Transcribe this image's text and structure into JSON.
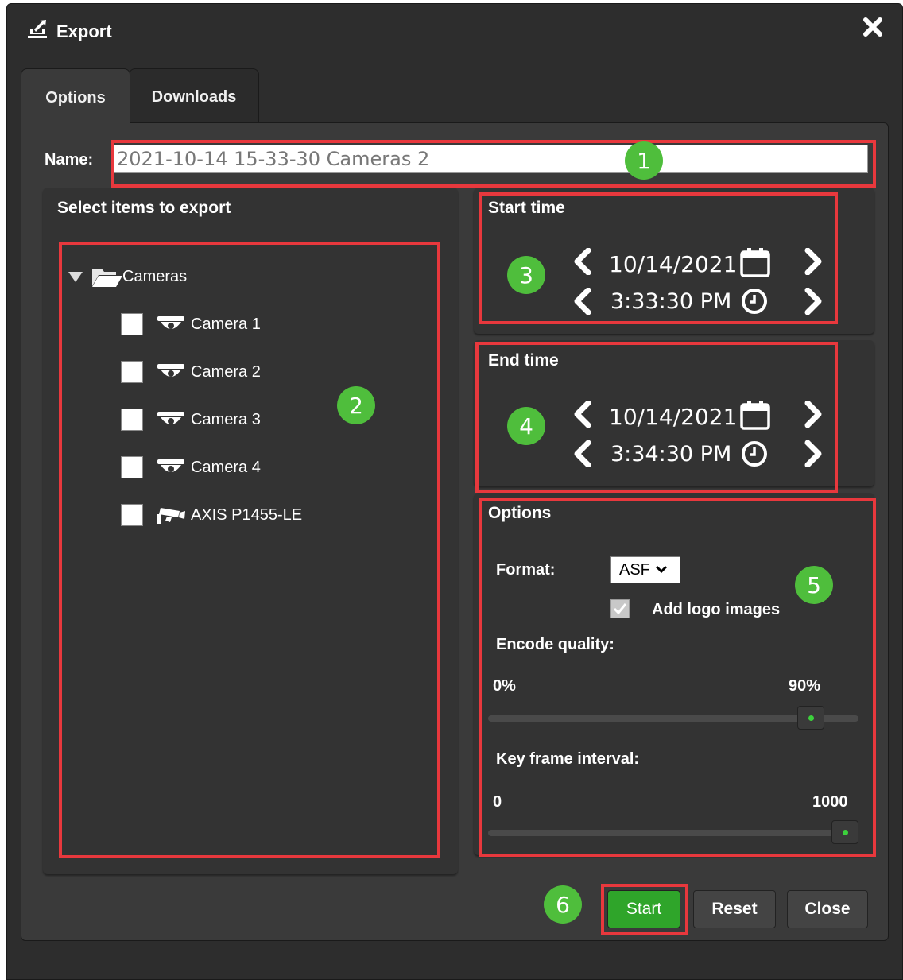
{
  "dialog": {
    "title": "Export",
    "accent_color": "#4fbe3c",
    "highlight_color": "#e8383d"
  },
  "tabs": [
    {
      "label": "Options",
      "active": true
    },
    {
      "label": "Downloads",
      "active": false
    }
  ],
  "name_field": {
    "label": "Name:",
    "value": "2021-10-14 15-33-30 Cameras 2"
  },
  "items_panel": {
    "title": "Select items to export",
    "root": {
      "label": "Cameras",
      "icon": "folder-open-icon",
      "expanded": true
    },
    "items": [
      {
        "label": "Camera 1",
        "icon": "dome-camera-icon",
        "checked": false
      },
      {
        "label": "Camera 2",
        "icon": "dome-camera-icon",
        "checked": false
      },
      {
        "label": "Camera 3",
        "icon": "dome-camera-icon",
        "checked": false
      },
      {
        "label": "Camera 4",
        "icon": "dome-camera-icon",
        "checked": false
      },
      {
        "label": "AXIS P1455-LE",
        "icon": "bullet-camera-icon",
        "checked": false
      }
    ]
  },
  "start_time": {
    "title": "Start time",
    "date": "10/14/2021",
    "time": "3:33:30 PM"
  },
  "end_time": {
    "title": "End time",
    "date": "10/14/2021",
    "time": "3:34:30 PM"
  },
  "options": {
    "title": "Options",
    "format_label": "Format:",
    "format_value": "ASF",
    "add_logo_label": "Add logo images",
    "add_logo_checked": true,
    "encode_quality_label": "Encode quality:",
    "encode_min": "0%",
    "encode_value_label": "90%",
    "encode_fraction": 0.9,
    "key_frame_label": "Key frame interval:",
    "key_frame_min": "0",
    "key_frame_value_label": "1000",
    "key_frame_fraction": 1.0
  },
  "badges": [
    "1",
    "2",
    "3",
    "4",
    "5",
    "6"
  ],
  "buttons": {
    "start": "Start",
    "reset": "Reset",
    "close": "Close"
  }
}
